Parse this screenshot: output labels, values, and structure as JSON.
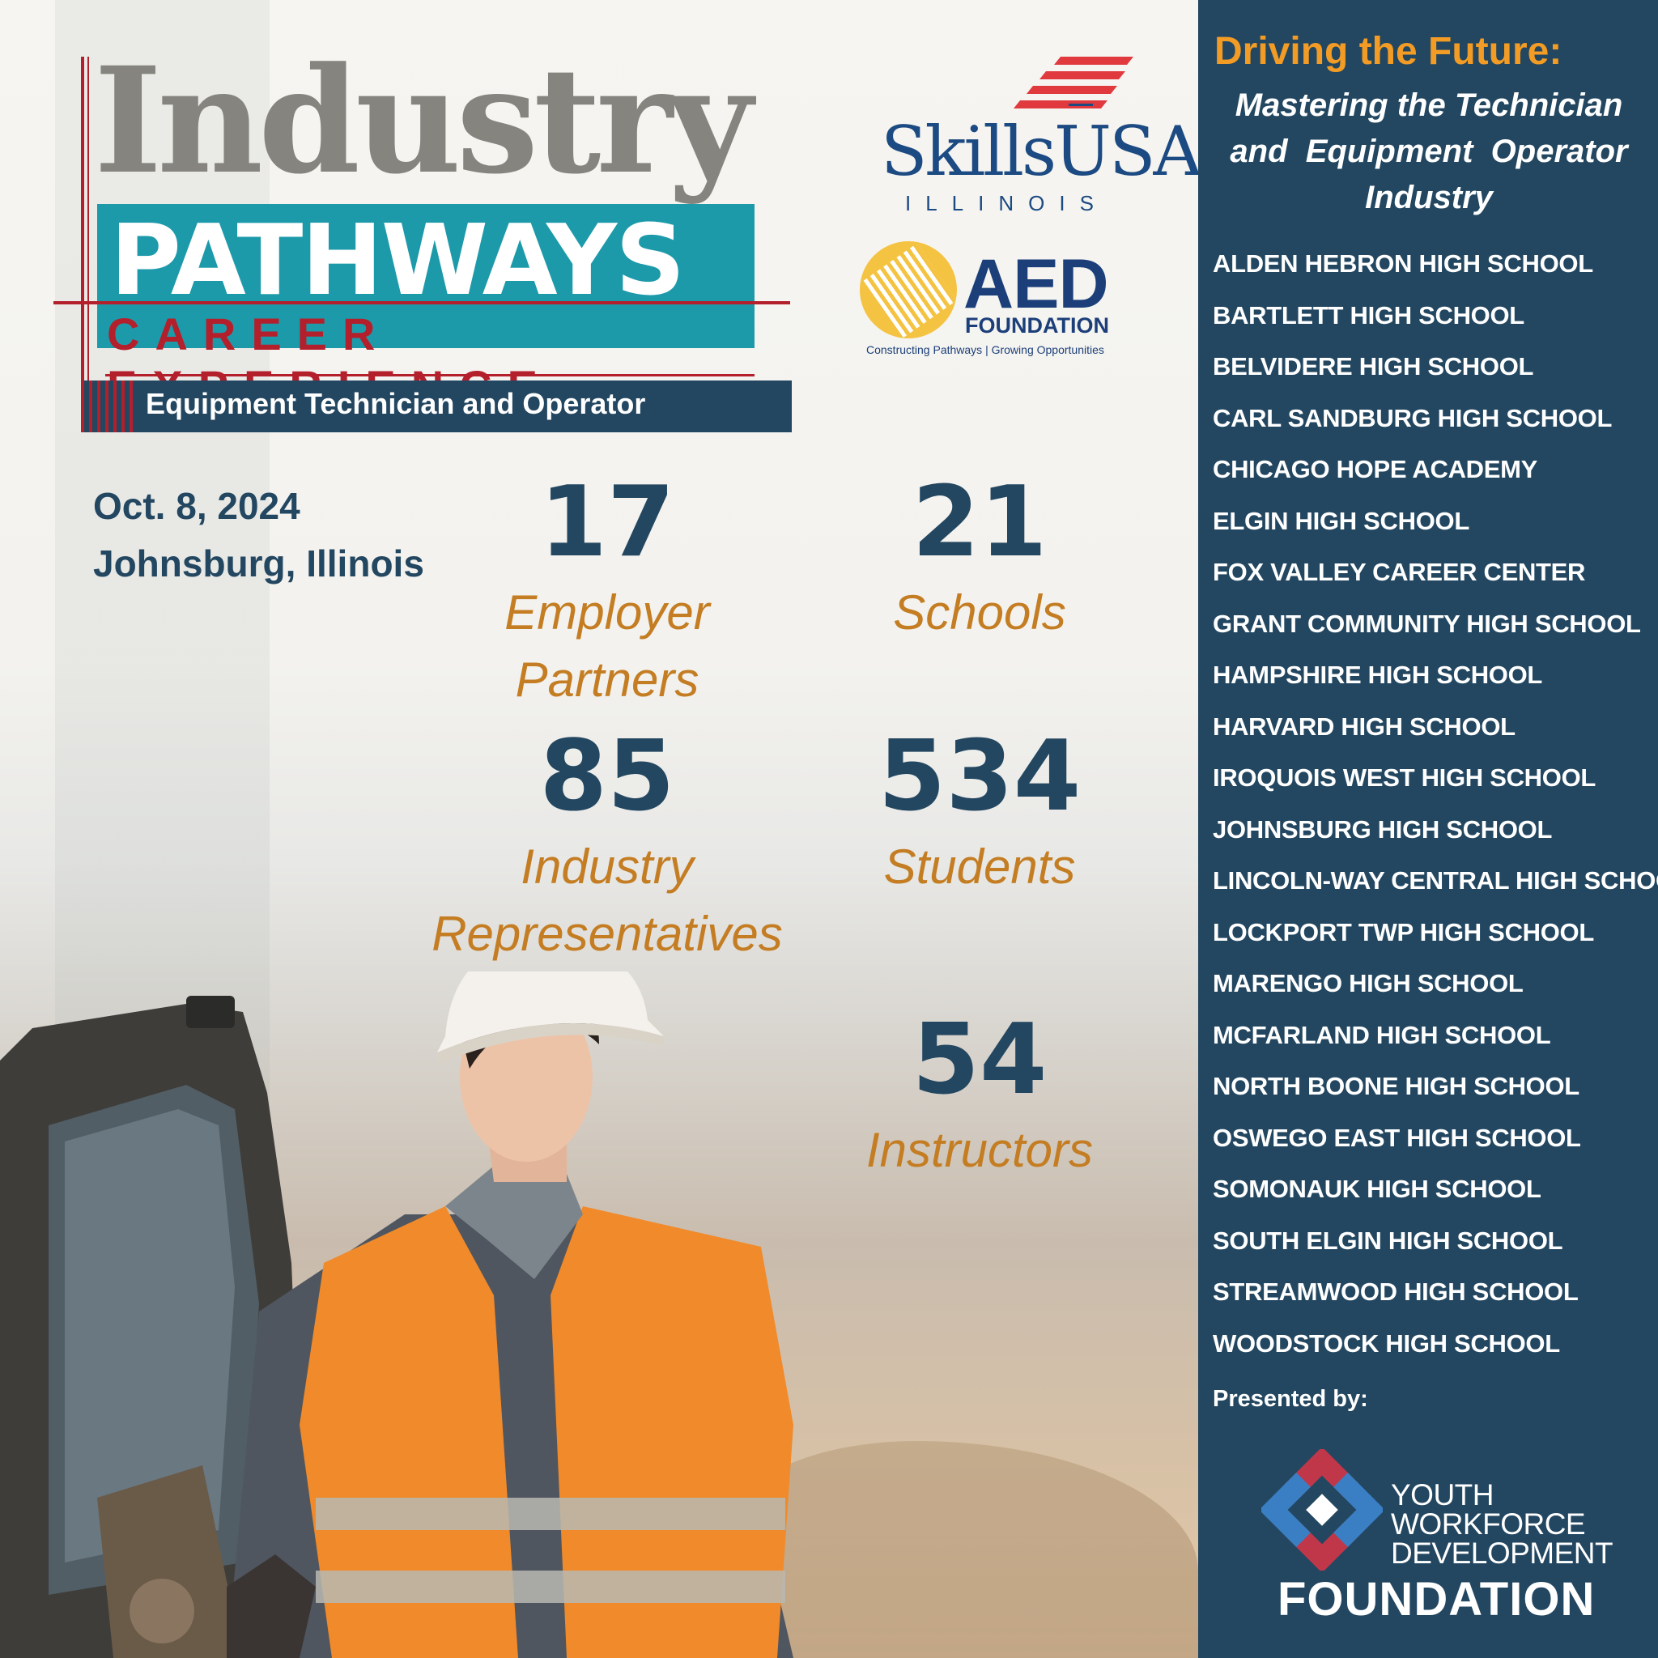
{
  "logo": {
    "industry": "Industry",
    "pathways": "PATHWAYS",
    "career_experience": "CAREER EXPERIENCE",
    "subtitle": "Equipment Technician and Operator"
  },
  "partners": {
    "skillsusa_name": "SkillsUSA",
    "skillsusa_state": "ILLINOIS",
    "aed_name": "AED",
    "aed_foundation": "FOUNDATION",
    "aed_tagline": "Constructing Pathways | Growing Opportunities"
  },
  "event": {
    "date": "Oct. 8, 2024",
    "location": "Johnsburg, Illinois"
  },
  "stats": [
    {
      "value": "17",
      "label_line1": "Employer",
      "label_line2": "Partners"
    },
    {
      "value": "21",
      "label_line1": "Schools",
      "label_line2": ""
    },
    {
      "value": "85",
      "label_line1": "Industry",
      "label_line2": "Representatives"
    },
    {
      "value": "534",
      "label_line1": "Students",
      "label_line2": ""
    },
    {
      "value": "54",
      "label_line1": "Instructors",
      "label_line2": ""
    }
  ],
  "panel": {
    "title": "Driving the Future:",
    "subtitle_line1": "Mastering the Technician",
    "subtitle_line2": "and  Equipment  Operator",
    "subtitle_line3": "Industry",
    "schools": [
      "ALDEN HEBRON HIGH SCHOOL",
      "BARTLETT HIGH SCHOOL",
      "BELVIDERE HIGH SCHOOL",
      "CARL SANDBURG HIGH SCHOOL",
      "CHICAGO HOPE ACADEMY",
      "ELGIN HIGH SCHOOL",
      "FOX VALLEY CAREER CENTER",
      "GRANT COMMUNITY HIGH SCHOOL",
      "HAMPSHIRE HIGH SCHOOL",
      "HARVARD HIGH SCHOOL",
      "IROQUOIS WEST HIGH SCHOOL",
      "JOHNSBURG HIGH SCHOOL",
      "LINCOLN-WAY CENTRAL HIGH SCHOOL",
      "LOCKPORT TWP HIGH SCHOOL",
      "MARENGO HIGH SCHOOL",
      "MCFARLAND HIGH SCHOOL",
      "NORTH BOONE HIGH SCHOOL",
      "OSWEGO EAST HIGH SCHOOL",
      "SOMONAUK HIGH SCHOOL",
      "SOUTH ELGIN HIGH SCHOOL",
      "STREAMWOOD HIGH SCHOOL",
      "WOODSTOCK HIGH SCHOOL"
    ],
    "presented_by": "Presented by:",
    "ywd_line1": "YOUTH",
    "ywd_line2": "WORKFORCE",
    "ywd_line3": "DEVELOPMENT",
    "ywd_foundation": "FOUNDATION"
  },
  "colors": {
    "navy": "#234761",
    "orange_label": "#c47d22",
    "panel_title": "#f29b25",
    "brand_red": "#b41f2c",
    "teal": "#1d9aaa",
    "vest_orange": "#f08a2a"
  }
}
